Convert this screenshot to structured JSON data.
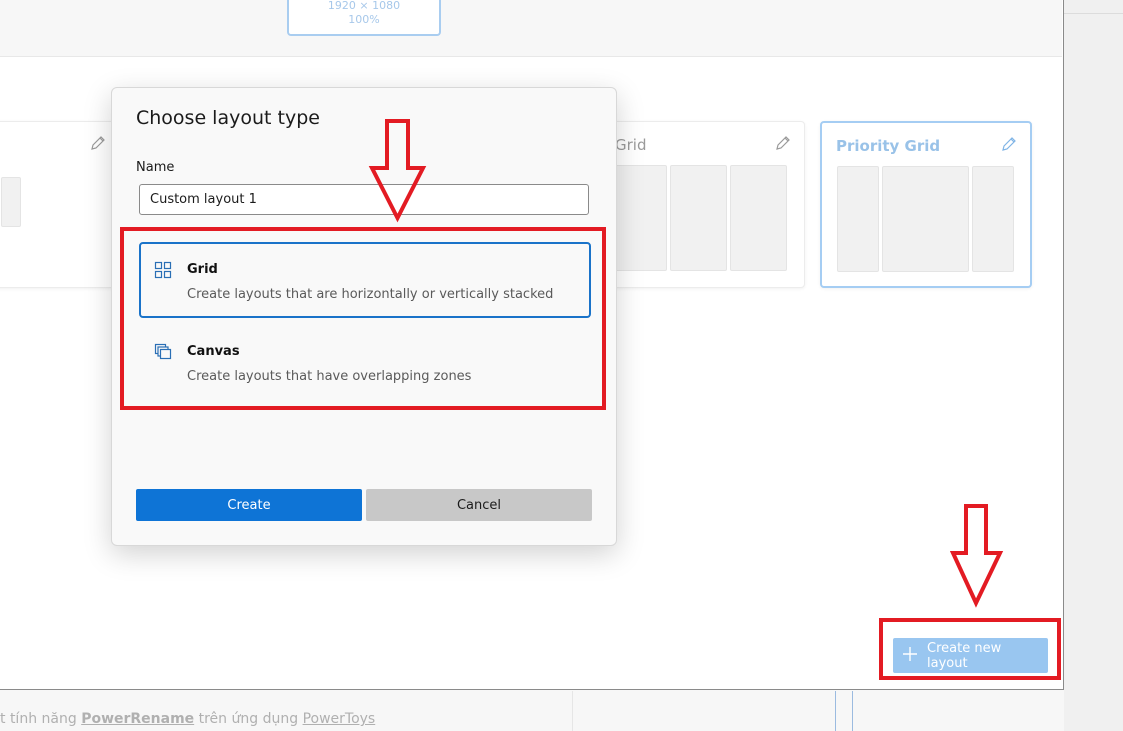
{
  "background": {
    "article_prefix": "t tính năng ",
    "article_bold": "PowerRename",
    "article_middle": " trên ứng dụng ",
    "article_link": "PowerToys"
  },
  "monitor": {
    "resolution": "1920 × 1080",
    "scale": "100%"
  },
  "layouts": {
    "grid_partial_title": "Grid",
    "priority_grid_title": "Priority Grid"
  },
  "dialog": {
    "title": "Choose layout type",
    "name_label": "Name",
    "name_value": "Custom layout 1",
    "options": [
      {
        "title": "Grid",
        "description": "Create layouts that are horizontally or vertically stacked",
        "selected": true,
        "icon": "grid-icon"
      },
      {
        "title": "Canvas",
        "description": "Create layouts that have overlapping zones",
        "selected": false,
        "icon": "canvas-icon"
      }
    ],
    "create_label": "Create",
    "cancel_label": "Cancel"
  },
  "create_new_layout_label": "Create new layout",
  "colors": {
    "accent": "#0e74d6",
    "annotation_red": "#e31b23",
    "selected_border": "#1a73c9"
  }
}
